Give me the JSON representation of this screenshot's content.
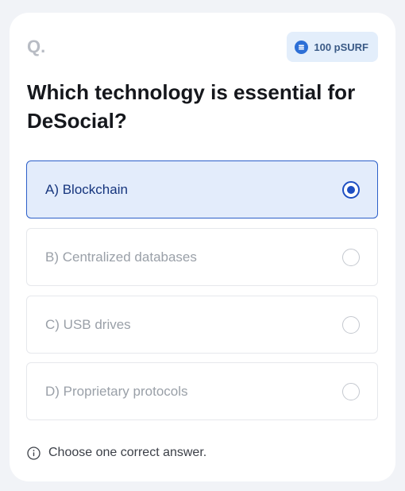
{
  "header": {
    "question_marker": "Q.",
    "reward": {
      "text": "100 pSURF",
      "icon": "coin-icon"
    }
  },
  "question": "Which technology is essential for DeSocial?",
  "options": [
    {
      "label": "A) Blockchain",
      "selected": true
    },
    {
      "label": "B) Centralized databases",
      "selected": false
    },
    {
      "label": "C) USB drives",
      "selected": false
    },
    {
      "label": "D) Proprietary protocols",
      "selected": false
    }
  ],
  "hint": {
    "text": "Choose one correct answer.",
    "icon": "info-icon"
  },
  "colors": {
    "accent": "#1f4fc2",
    "selected_bg": "#e3ecfb",
    "reward_bg": "#e3eefb"
  }
}
